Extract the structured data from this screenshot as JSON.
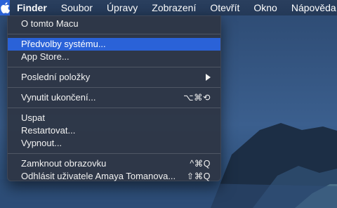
{
  "menubar": {
    "apple_icon": "apple-logo-icon",
    "items": [
      "Finder",
      "Soubor",
      "Úpravy",
      "Zobrazení",
      "Otevřít",
      "Okno",
      "Nápověda"
    ]
  },
  "apple_menu": {
    "about": "O tomto Macu",
    "preferences": "Předvolby systému...",
    "app_store": "App Store...",
    "recent_items": "Poslední položky",
    "recent_submenu_icon": "submenu-arrow-icon",
    "force_quit": "Vynutit ukončení...",
    "force_quit_shortcut": "⌥⌘⟲",
    "sleep": "Uspat",
    "restart": "Restartovat...",
    "shutdown": "Vypnout...",
    "lock_screen": "Zamknout obrazovku",
    "lock_screen_shortcut": "^⌘Q",
    "logout": "Odhlásit uživatele Amaya Tomanova...",
    "logout_shortcut": "⇧⌘Q"
  },
  "colors": {
    "highlight": "#2a62d8",
    "menubar": "#243958"
  }
}
